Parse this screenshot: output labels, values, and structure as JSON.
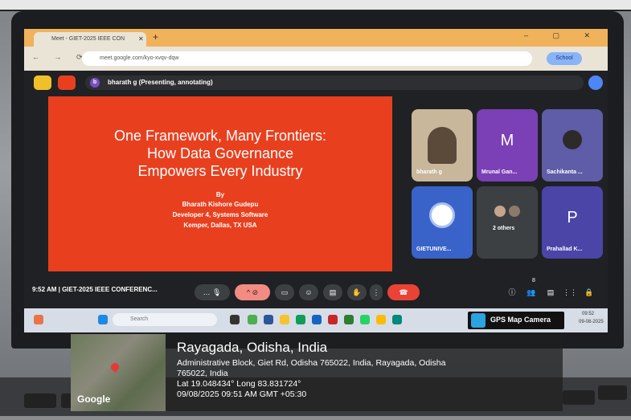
{
  "browser": {
    "tab_title": "Meet - GIET-2025 IEEE CON",
    "url": "meet.google.com/kyo-xvqv-dqw",
    "profile_label": "School"
  },
  "meet": {
    "presenting_banner": "bharath g (Presenting, annotating)",
    "avatar_initial": "b",
    "slide": {
      "title_lines": [
        "One Framework, Many Frontiers:",
        "How Data Governance",
        "Empowers Every Industry"
      ],
      "by": "By",
      "author": "Bharath Kishore Gudepu",
      "role": "Developer 4, Systems Software",
      "org": "Kemper, Dallas, TX USA"
    },
    "participants": [
      {
        "name": "bharath g",
        "initial": "",
        "color": "#c9b79c"
      },
      {
        "name": "Mrunal Gan...",
        "initial": "M",
        "color": "#7b3fb6"
      },
      {
        "name": "Sachikanta ...",
        "initial": "",
        "color": "#5f5ca8"
      },
      {
        "name": "GIETUNIVE...",
        "initial": "",
        "color": "#3a63c9"
      },
      {
        "name": "2 others",
        "initial": "",
        "color": "#3c4043"
      },
      {
        "name": "Prahallad K...",
        "initial": "P",
        "color": "#4b45a8"
      }
    ],
    "time": "9:52 AM",
    "meeting_name": "GIET-2025 IEEE CONFERENC...",
    "people_count": "8"
  },
  "taskbar": {
    "search_placeholder": "Search",
    "clock_time": "09:52",
    "clock_date": "09-08-2025"
  },
  "gps": {
    "label": "GPS Map Camera",
    "location_title": "Rayagada, Odisha, India",
    "address_line1": "Administrative Block, Giet Rd, Odisha 765022, India, Rayagada, Odisha",
    "address_line2": "765022, India",
    "latlong": "Lat 19.048434° Long 83.831724°",
    "timestamp": "09/08/2025 09:51 AM GMT +05:30",
    "map_brand": "Google"
  }
}
